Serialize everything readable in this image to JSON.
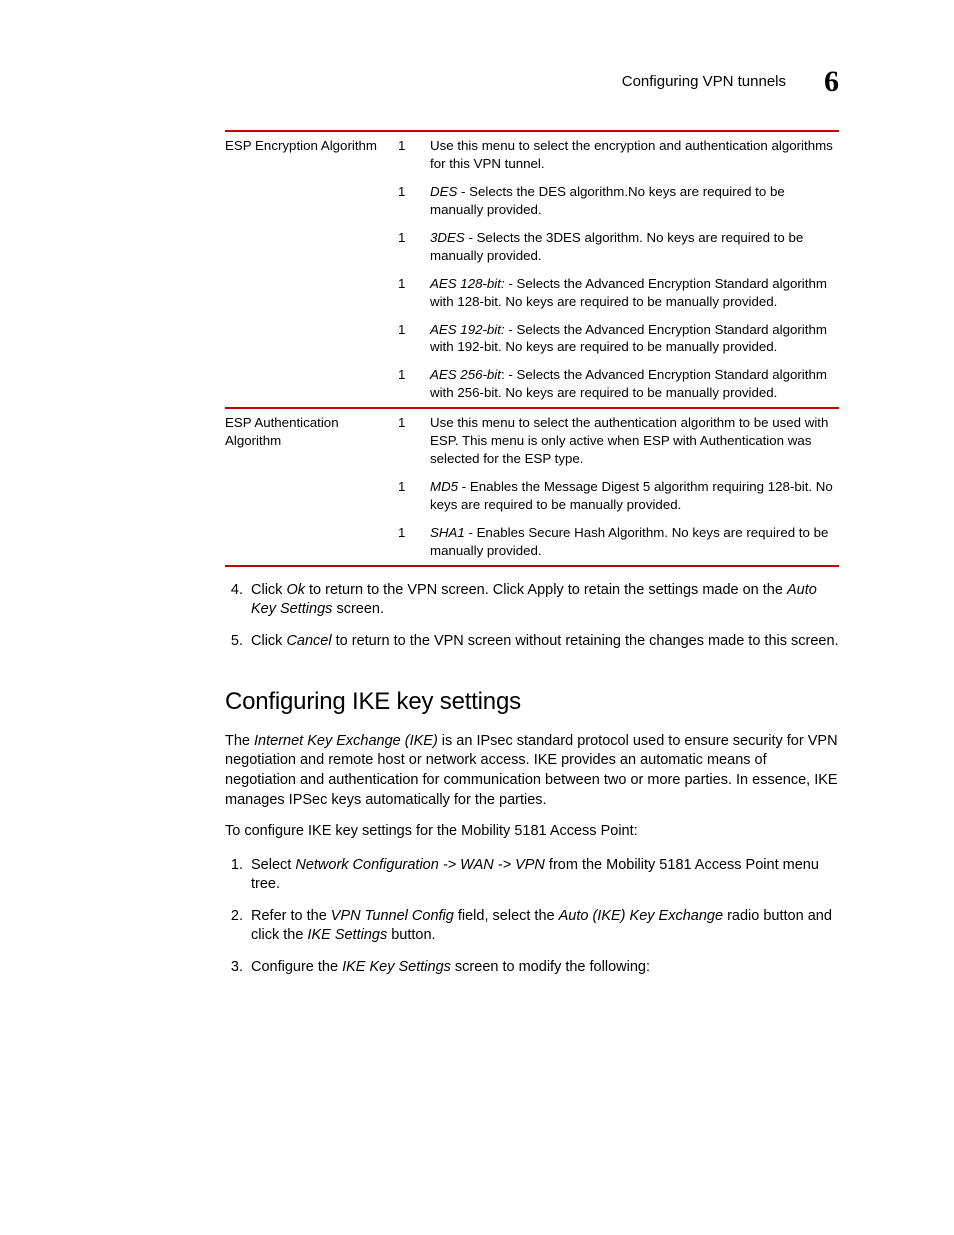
{
  "header": {
    "running_title": "Configuring VPN tunnels",
    "chapter_number": "6"
  },
  "table": {
    "rows": [
      {
        "label": "ESP Encryption Algorithm",
        "items": [
          {
            "bullet": "1",
            "text_parts": [
              {
                "plain": "Use this menu to select the encryption and authentication algorithms for this VPN tunnel."
              }
            ]
          },
          {
            "bullet": "1",
            "text_parts": [
              {
                "italic": "DES"
              },
              {
                "plain": " - Selects the DES algorithm.No keys are required to be manually provided."
              }
            ]
          },
          {
            "bullet": "1",
            "text_parts": [
              {
                "italic": "3DES"
              },
              {
                "plain": " - Selects the 3DES algorithm. No keys are required to be manually provided."
              }
            ]
          },
          {
            "bullet": "1",
            "text_parts": [
              {
                "italic": "AES 128-bit:"
              },
              {
                "plain": " - Selects the Advanced Encryption Standard algorithm with 128-bit. No keys are required to be manually provided."
              }
            ]
          },
          {
            "bullet": "1",
            "text_parts": [
              {
                "italic": "AES 192-bit:"
              },
              {
                "plain": " - Selects the Advanced Encryption Standard algorithm with 192-bit. No keys are required to be manually provided."
              }
            ]
          },
          {
            "bullet": "1",
            "text_parts": [
              {
                "italic": "AES 256-bit"
              },
              {
                "plain": ": - Selects the Advanced Encryption Standard algorithm with 256-bit. No keys are required to be manually provided."
              }
            ]
          }
        ]
      },
      {
        "label": "ESP Authentication Algorithm",
        "items": [
          {
            "bullet": "1",
            "text_parts": [
              {
                "plain": "Use this menu to select the authentication algorithm to be used with ESP. This menu is only active when ESP with Authentication was selected for the ESP type."
              }
            ]
          },
          {
            "bullet": "1",
            "text_parts": [
              {
                "italic": "MD5"
              },
              {
                "plain": " - Enables the Message Digest 5 algorithm requiring 128-bit. No keys are required to be manually provided."
              }
            ]
          },
          {
            "bullet": "1",
            "text_parts": [
              {
                "italic": "SHA1"
              },
              {
                "plain": " - Enables Secure Hash Algorithm. No keys are required to be manually provided."
              }
            ]
          }
        ]
      }
    ]
  },
  "steps_a": [
    {
      "num": "4.",
      "parts": [
        {
          "plain": "Click "
        },
        {
          "italic": "Ok"
        },
        {
          "plain": " to return to the VPN screen. Click Apply to retain the settings made on the "
        },
        {
          "italic": "Auto Key Settings"
        },
        {
          "plain": " screen."
        }
      ]
    },
    {
      "num": "5.",
      "parts": [
        {
          "plain": "Click "
        },
        {
          "italic": "Cancel"
        },
        {
          "plain": " to return to the VPN screen without retaining the changes made to this screen."
        }
      ]
    }
  ],
  "section": {
    "heading": "Configuring IKE key settings",
    "intro_parts": [
      {
        "plain": "The "
      },
      {
        "italic": "Internet Key Exchange (IKE)"
      },
      {
        "plain": " is an IPsec standard protocol used to ensure security for VPN negotiation and remote host or network access. IKE provides an automatic means of negotiation and authentication for communication between two or more parties. In essence, IKE manages IPSec keys automatically for the parties."
      }
    ],
    "lead": "To configure IKE key settings for the Mobility 5181 Access Point:",
    "steps": [
      {
        "num": "1.",
        "parts": [
          {
            "plain": "Select "
          },
          {
            "italic": "Network Configuration -> WAN -> VPN"
          },
          {
            "plain": " from the Mobility 5181 Access Point menu tree."
          }
        ]
      },
      {
        "num": "2.",
        "parts": [
          {
            "plain": "Refer to the "
          },
          {
            "italic": "VPN Tunnel Config"
          },
          {
            "plain": " field, select the "
          },
          {
            "italic": "Auto (IKE) Key Exchange"
          },
          {
            "plain": " radio button and click the "
          },
          {
            "italic": "IKE Settings"
          },
          {
            "plain": " button."
          }
        ]
      },
      {
        "num": "3.",
        "parts": [
          {
            "plain": "Configure the "
          },
          {
            "italic": "IKE Key Settings"
          },
          {
            "plain": " screen to modify the following:"
          }
        ]
      }
    ]
  }
}
